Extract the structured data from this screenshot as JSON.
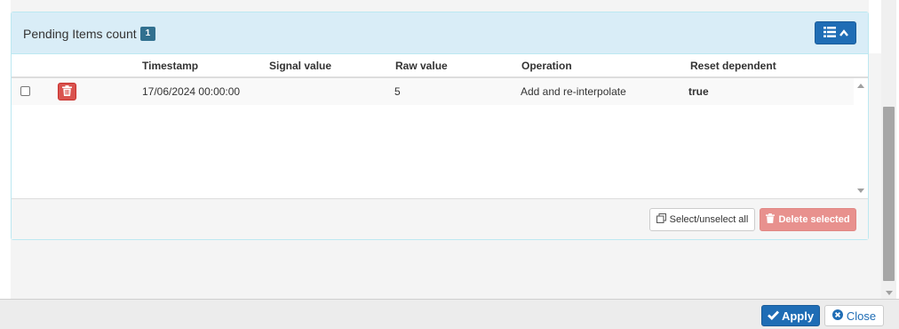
{
  "panel": {
    "title": "Pending Items count",
    "count": "1"
  },
  "columns": [
    "Timestamp",
    "Signal value",
    "Raw value",
    "Operation",
    "Reset dependent"
  ],
  "rows": [
    {
      "timestamp": "17/06/2024 00:00:00",
      "signal_value": "",
      "raw_value": "5",
      "operation": "Add and re-interpolate",
      "reset_dependent": "true",
      "checked": false
    }
  ],
  "footer": {
    "select_all_label": "Select/unselect all",
    "delete_selected_label": "Delete selected"
  },
  "dialog": {
    "apply_label": "Apply",
    "close_label": "Close"
  },
  "colors": {
    "primary": "#1f6db5",
    "danger": "#d9534f",
    "danger_disabled": "#e8918e",
    "panel_heading": "#d9edf7",
    "badge": "#31708f"
  },
  "icons": {
    "toggle": "list-icon",
    "toggle_caret": "chevron-up-icon",
    "row_delete": "trash-icon",
    "select_all": "copy-icon",
    "delete_selected": "trash-icon",
    "apply": "checkmark-icon",
    "close": "close-circle-icon"
  }
}
